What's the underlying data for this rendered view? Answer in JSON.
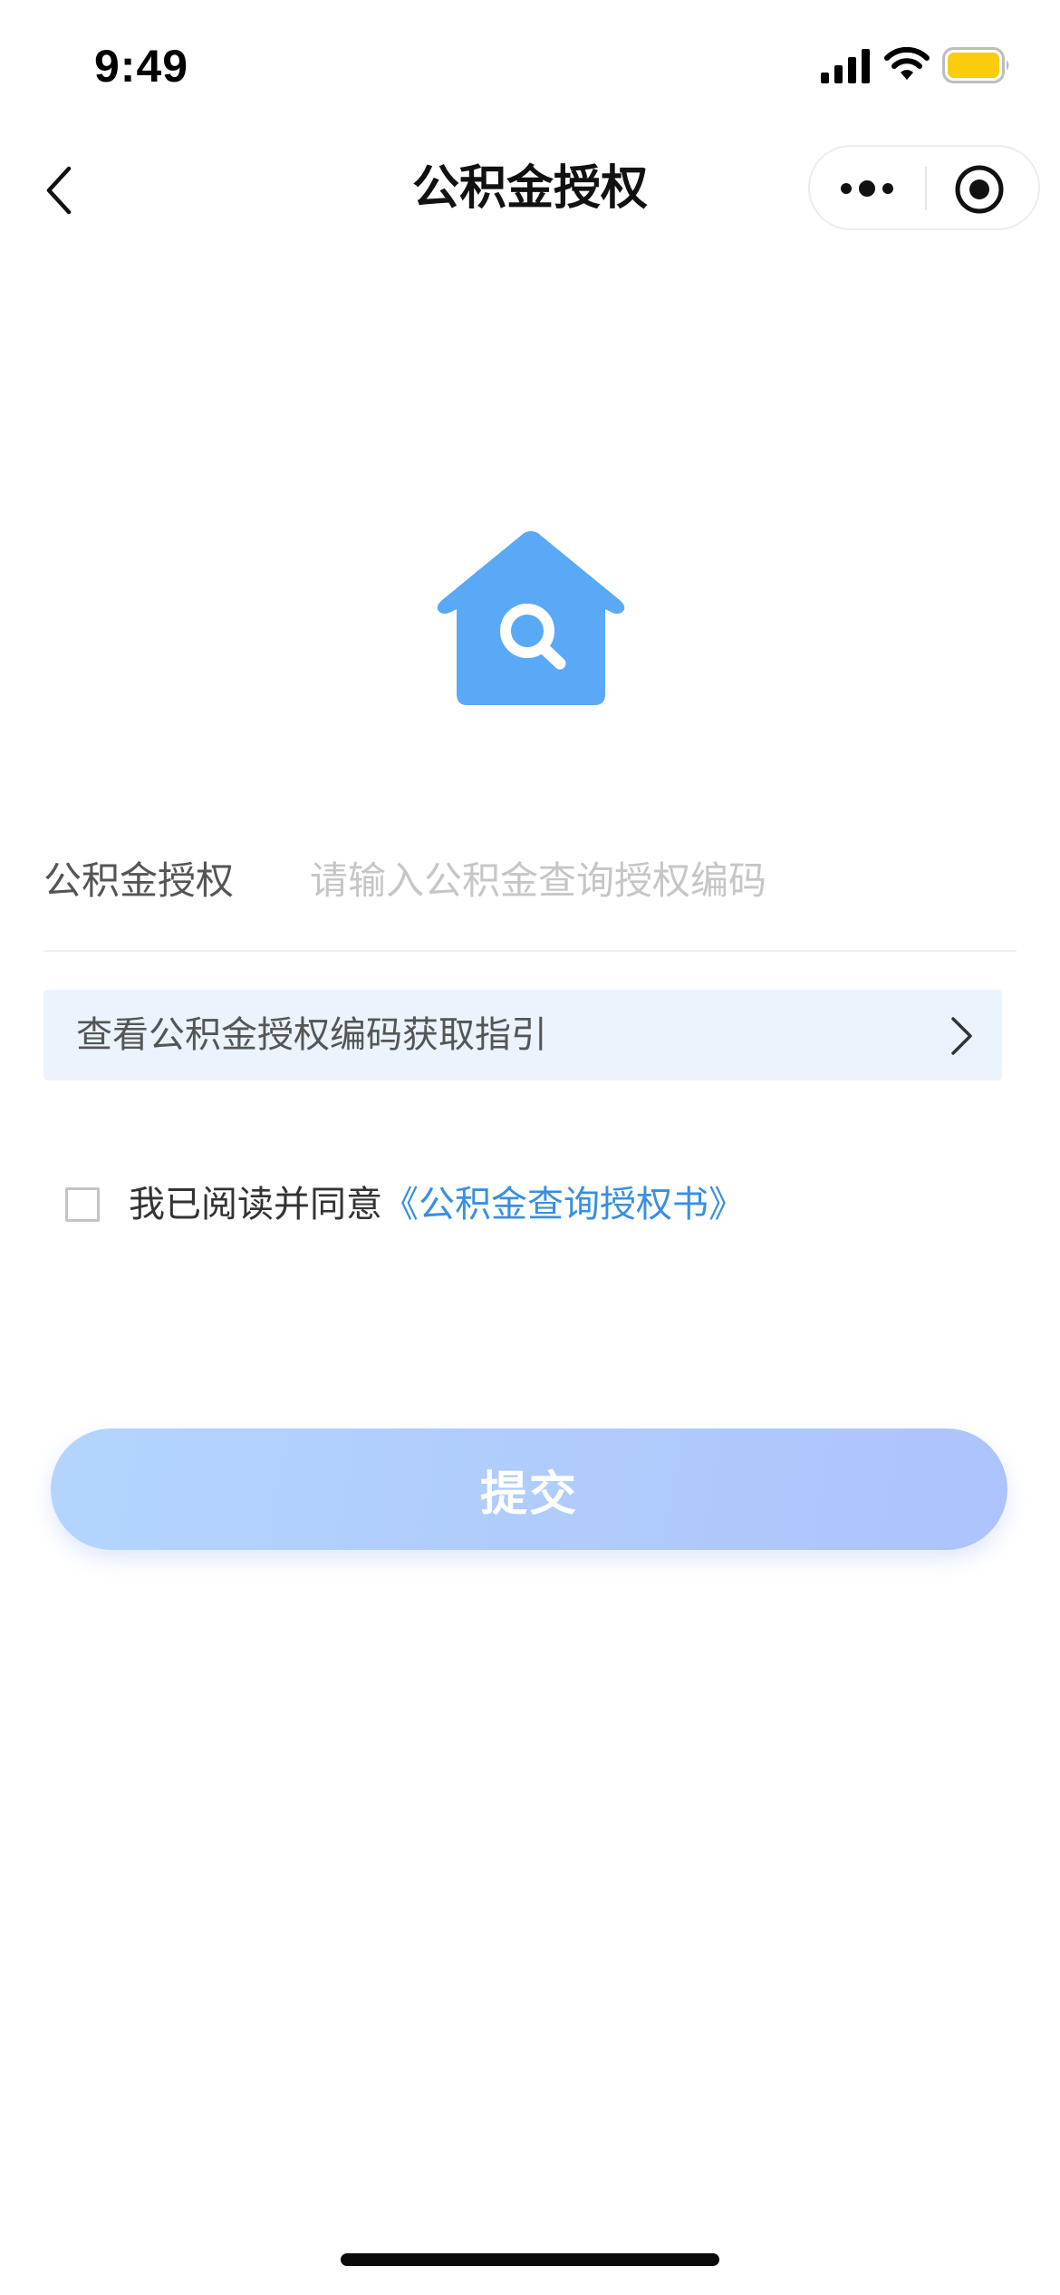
{
  "status_bar": {
    "time": "9:49",
    "icons": [
      "signal-icon",
      "wifi-icon",
      "battery-icon"
    ],
    "battery_color": "#f9cd0b"
  },
  "nav": {
    "title": "公积金授权",
    "icons": [
      "back-icon",
      "more-icon",
      "close-mini-icon"
    ]
  },
  "hero": {
    "icon": "house-search-icon",
    "color": "#5aa9f6"
  },
  "form": {
    "label": "公积金授权",
    "input_value": "",
    "input_placeholder": "请输入公积金查询授权编码"
  },
  "guide": {
    "text": "查看公积金授权编码获取指引",
    "background": "#ebf4fd"
  },
  "agreement": {
    "checked": false,
    "prefix": "我已阅读并同意",
    "link": "《公积金查询授权书》",
    "link_color": "#3a8fe0"
  },
  "submit": {
    "label": "提交"
  }
}
